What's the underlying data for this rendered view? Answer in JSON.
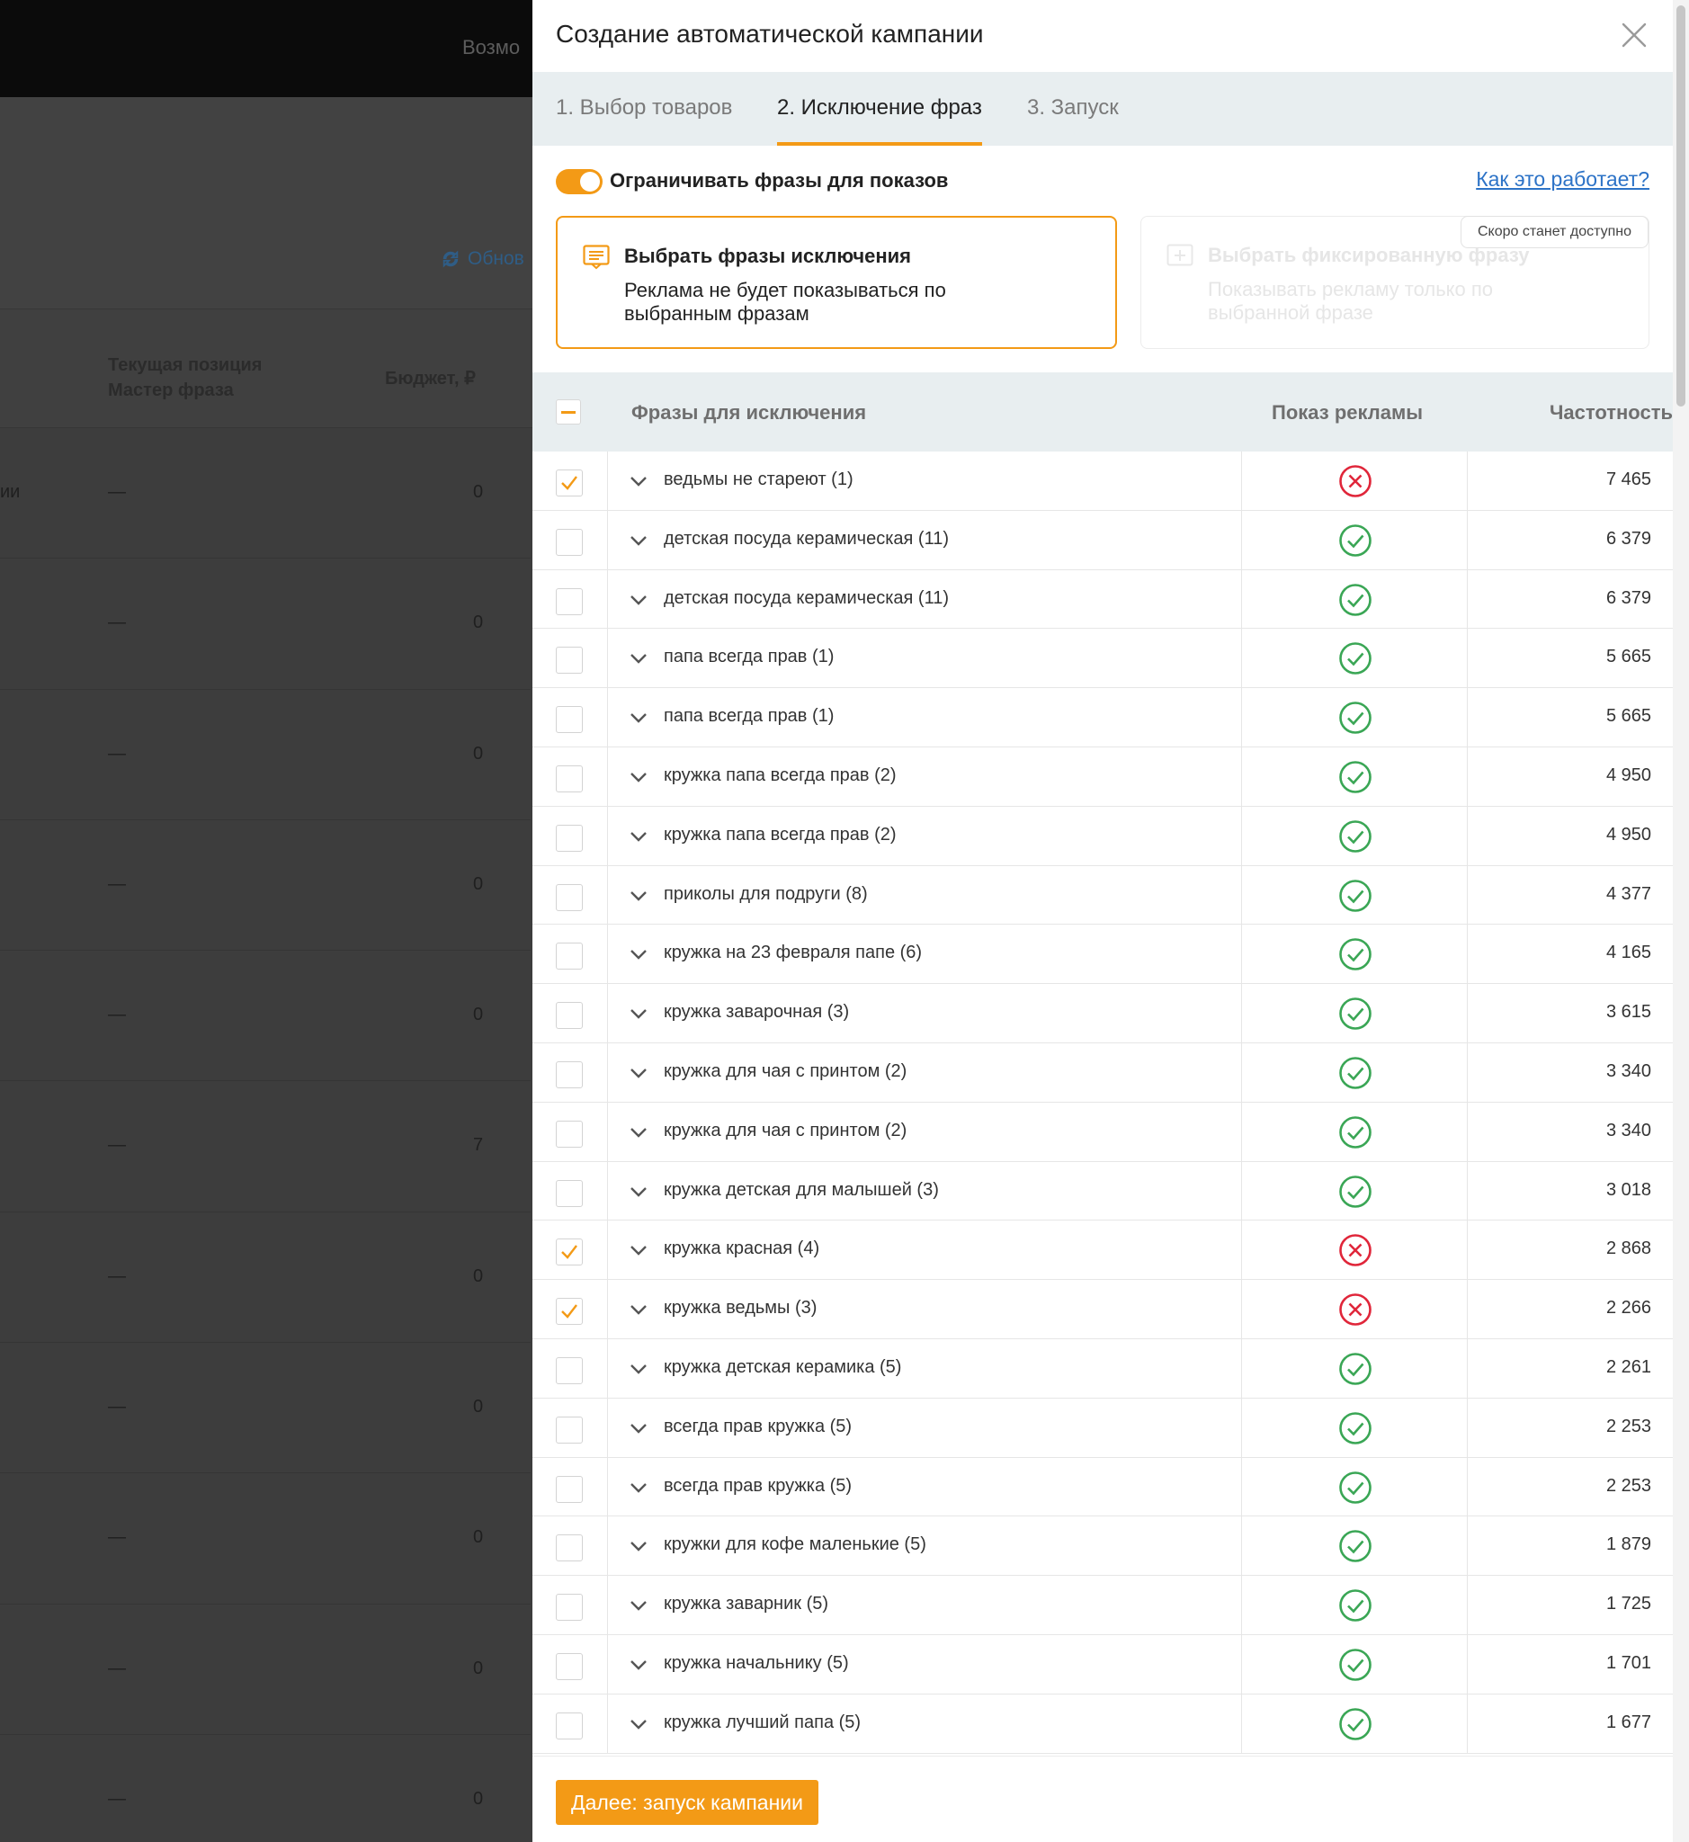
{
  "background": {
    "top_text": "Возмо",
    "refresh_label": "Обнов",
    "col_position": "Текущая позиция Мастер фраза",
    "col_budget": "Бюджет, ₽",
    "rows": [
      {
        "left": "ии",
        "dash": "—",
        "num": "0"
      },
      {
        "left": "",
        "dash": "—",
        "num": "0"
      },
      {
        "left": "",
        "dash": "—",
        "num": "0"
      },
      {
        "left": "",
        "dash": "—",
        "num": "0"
      },
      {
        "left": "",
        "dash": "—",
        "num": "0"
      },
      {
        "left": "",
        "dash": "—",
        "num": "7"
      },
      {
        "left": "",
        "dash": "—",
        "num": "0"
      },
      {
        "left": "",
        "dash": "—",
        "num": "0"
      },
      {
        "left": "",
        "dash": "—",
        "num": "0"
      },
      {
        "left": "",
        "dash": "—",
        "num": "0"
      },
      {
        "left": "",
        "dash": "—",
        "num": "0"
      }
    ]
  },
  "modal": {
    "title": "Создание автоматической кампании",
    "tabs": [
      {
        "label": "1. Выбор товаров",
        "active": false
      },
      {
        "label": "2. Исключение фраз",
        "active": true
      },
      {
        "label": "3. Запуск",
        "active": false
      }
    ],
    "toggle": {
      "label": "Ограничивать фразы для показов",
      "on": true
    },
    "help_link": "Как это работает?",
    "card_exclude": {
      "title": "Выбрать фразы исключения",
      "description": "Реклама не будет показываться по выбранным фразам"
    },
    "card_fixed": {
      "title": "Выбрать фиксированную фразу",
      "description": "Показывать рекламу только по выбранной фразе",
      "badge": "Скоро станет доступно"
    },
    "table": {
      "col_phrases": "Фразы для исключения",
      "col_show": "Показ рекламы",
      "col_freq": "Частотность",
      "rows": [
        {
          "checked": true,
          "phrase": "ведьмы не стареют (1)",
          "show": false,
          "freq": "7 465"
        },
        {
          "checked": false,
          "phrase": "детская посуда керамическая (11)",
          "show": true,
          "freq": "6 379"
        },
        {
          "checked": false,
          "phrase": "детская посуда керамическая (11)",
          "show": true,
          "freq": "6 379"
        },
        {
          "checked": false,
          "phrase": "папа всегда прав (1)",
          "show": true,
          "freq": "5 665"
        },
        {
          "checked": false,
          "phrase": "папа всегда прав (1)",
          "show": true,
          "freq": "5 665"
        },
        {
          "checked": false,
          "phrase": "кружка папа всегда прав (2)",
          "show": true,
          "freq": "4 950"
        },
        {
          "checked": false,
          "phrase": "кружка папа всегда прав (2)",
          "show": true,
          "freq": "4 950"
        },
        {
          "checked": false,
          "phrase": "приколы для подруги (8)",
          "show": true,
          "freq": "4 377"
        },
        {
          "checked": false,
          "phrase": "кружка на 23 февраля папе (6)",
          "show": true,
          "freq": "4 165"
        },
        {
          "checked": false,
          "phrase": "кружка заварочная (3)",
          "show": true,
          "freq": "3 615"
        },
        {
          "checked": false,
          "phrase": "кружка для чая с принтом (2)",
          "show": true,
          "freq": "3 340"
        },
        {
          "checked": false,
          "phrase": "кружка для чая с принтом (2)",
          "show": true,
          "freq": "3 340"
        },
        {
          "checked": false,
          "phrase": "кружка детская для малышей (3)",
          "show": true,
          "freq": "3 018"
        },
        {
          "checked": true,
          "phrase": "кружка красная (4)",
          "show": false,
          "freq": "2 868"
        },
        {
          "checked": true,
          "phrase": "кружка ведьмы (3)",
          "show": false,
          "freq": "2 266"
        },
        {
          "checked": false,
          "phrase": "кружка детская керамика (5)",
          "show": true,
          "freq": "2 261"
        },
        {
          "checked": false,
          "phrase": "всегда прав кружка (5)",
          "show": true,
          "freq": "2 253"
        },
        {
          "checked": false,
          "phrase": "всегда прав кружка (5)",
          "show": true,
          "freq": "2 253"
        },
        {
          "checked": false,
          "phrase": "кружки для кофе маленькие (5)",
          "show": true,
          "freq": "1 879"
        },
        {
          "checked": false,
          "phrase": "кружка заварник (5)",
          "show": true,
          "freq": "1 725"
        },
        {
          "checked": false,
          "phrase": "кружка начальнику (5)",
          "show": true,
          "freq": "1 701"
        },
        {
          "checked": false,
          "phrase": "кружка лучший папа (5)",
          "show": true,
          "freq": "1 677"
        }
      ]
    },
    "next_button": "Далее: запуск кампании"
  },
  "colors": {
    "accent": "#f39a16",
    "ok": "#3aa655",
    "error": "#e0263a",
    "link": "#2d73c7"
  }
}
